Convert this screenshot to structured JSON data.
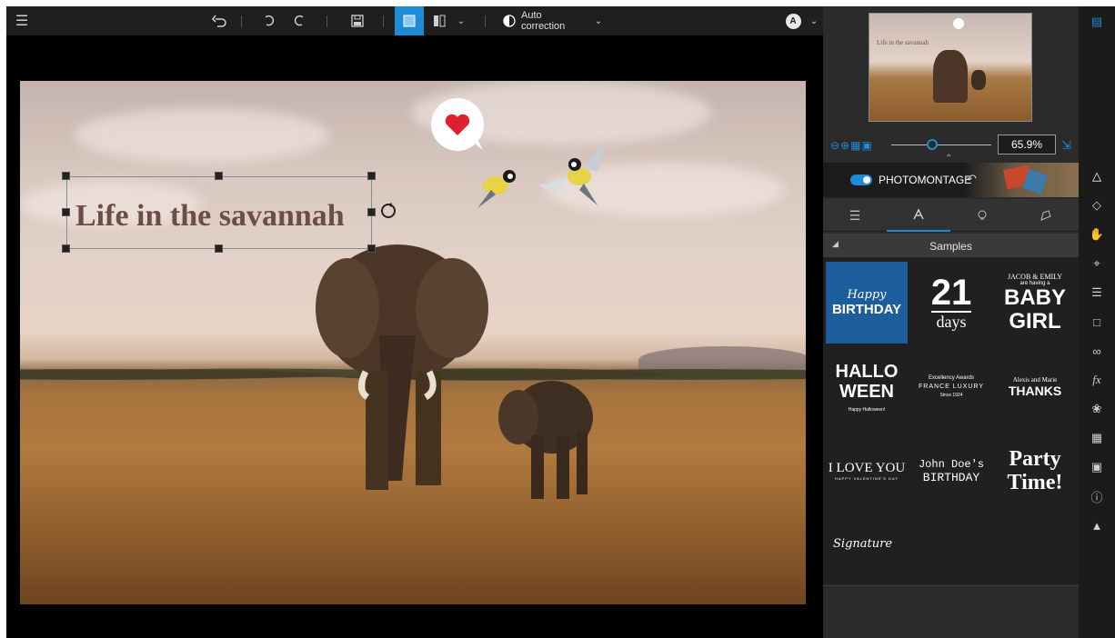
{
  "toolbar": {
    "menu_icon": "hamburger-icon",
    "auto_correction_label": "Auto correction",
    "accent": "#1e8bd6",
    "user_initial": "A"
  },
  "canvas": {
    "text_layer": "Life in the savannah"
  },
  "panel": {
    "zoom_value": "65.9%",
    "thumb_text": "Life in the savannah",
    "photomontage_label": "PHOTOMONTAGE",
    "samples_title": "Samples",
    "samples": {
      "happy": "Happy",
      "birthday": "BIRTHDAY",
      "big_num": "21",
      "days": "days",
      "jacob": "JACOB & EMILY",
      "having": "are having a",
      "baby": "BABY",
      "girl": "GIRL",
      "hallo": "HALLO",
      "ween": "WEEN",
      "halloween_small": "Happy Halloween!",
      "excellency": "Excellency Awards",
      "france": "FRANCE LUXURY",
      "since": "Since 1924",
      "alexis": "Alexis and Marie",
      "thanks": "THANKS",
      "ilove": "I LOVE YOU",
      "valentine": "HAPPY VALENTINE'S DAY",
      "john": "John Doe's",
      "jbirthday": "BIRTHDAY",
      "party": "Party",
      "time": "Time!",
      "signature": "Signature"
    }
  }
}
